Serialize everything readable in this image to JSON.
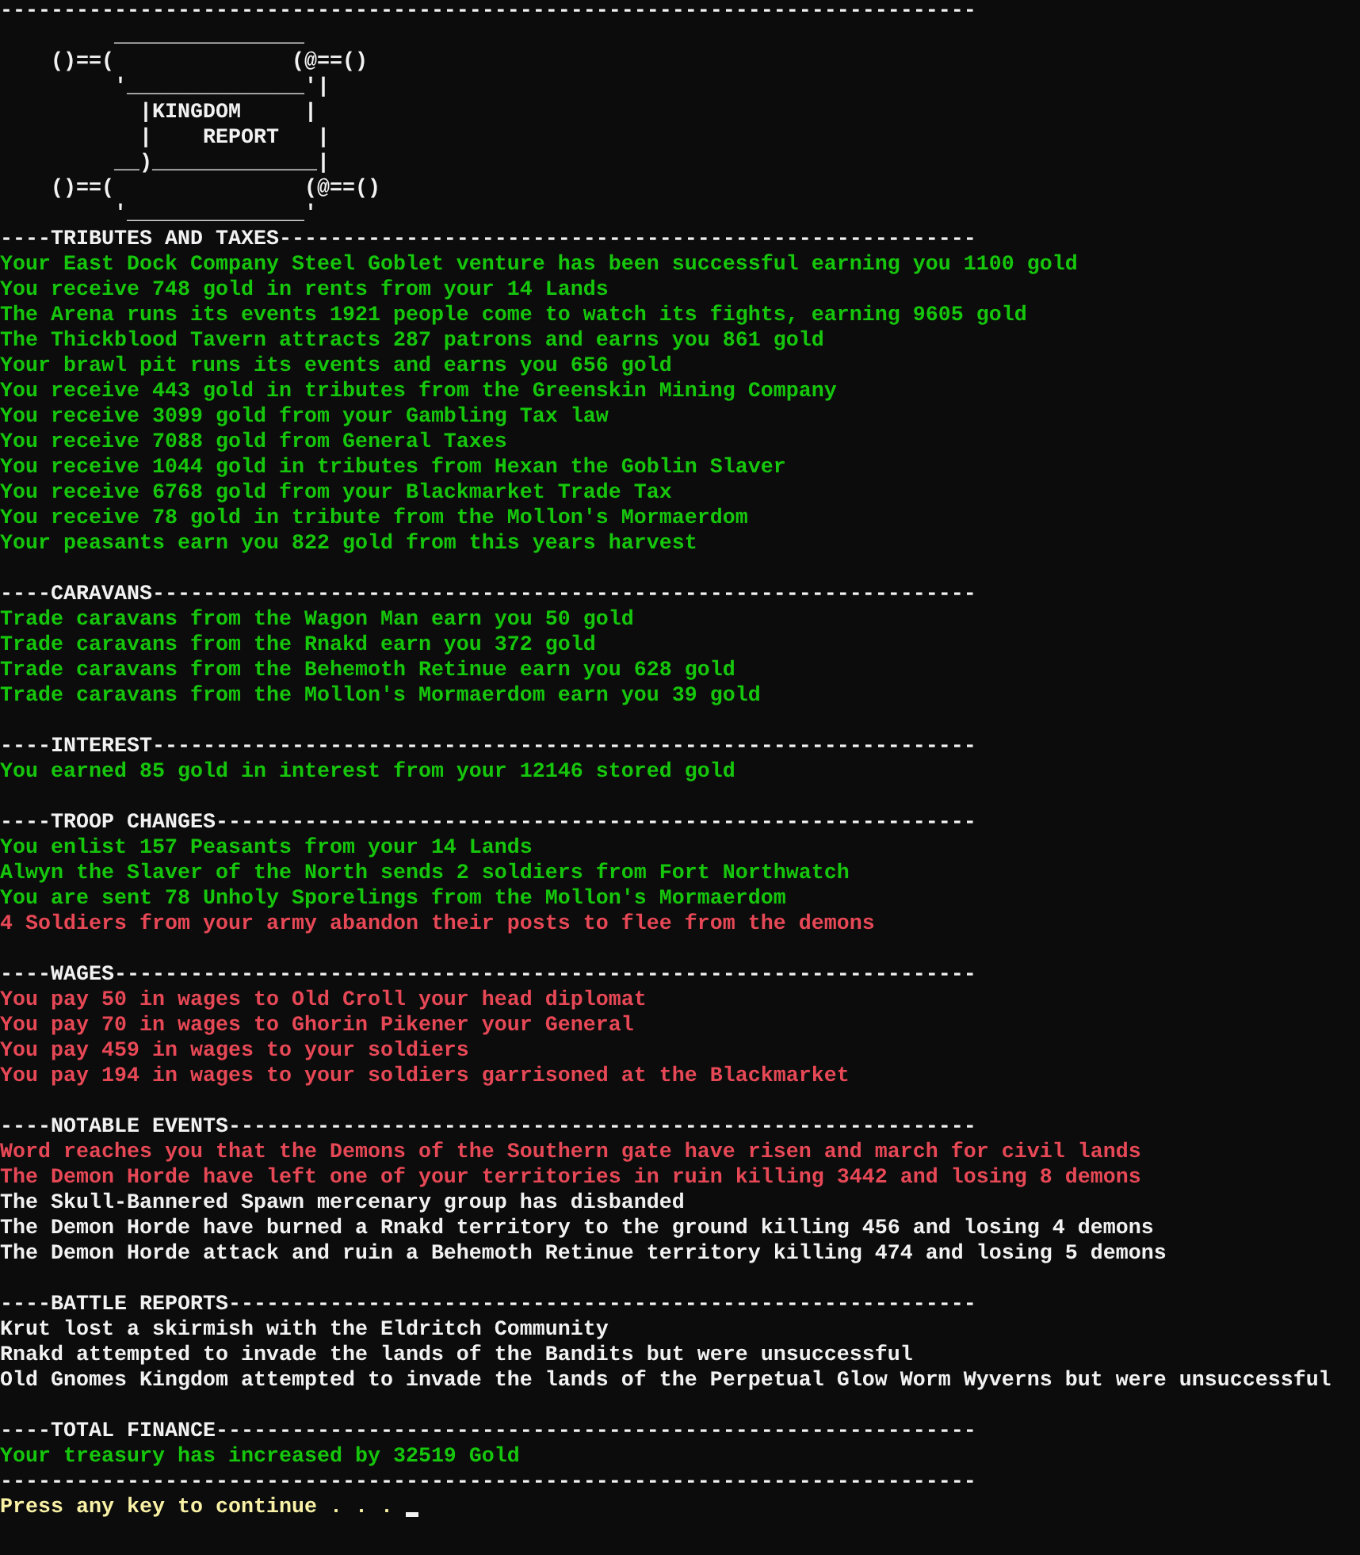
{
  "top_rule": "-----------------------------------------------------------------------------",
  "banner": [
    "         _______________",
    "    ()==(              (@==()",
    "         '______________'|",
    "           |KINGDOM     |",
    "           |    REPORT   |",
    "         __)_____________|",
    "    ()==(               (@==()",
    "         '______________'"
  ],
  "sections": [
    {
      "header": "----TRIBUTES AND TAXES-------------------------------------------------------",
      "lines": [
        {
          "text": "Your East Dock Company Steel Goblet venture has been successful earning you 1100 gold",
          "color": "#16c60c"
        },
        {
          "text": "You receive 748 gold in rents from your 14 Lands",
          "color": "#16c60c"
        },
        {
          "text": "The Arena runs its events 1921 people come to watch its fights, earning 9605 gold",
          "color": "#16c60c"
        },
        {
          "text": "The Thickblood Tavern attracts 287 patrons and earns you 861 gold",
          "color": "#16c60c"
        },
        {
          "text": "Your brawl pit runs its events and earns you 656 gold",
          "color": "#16c60c"
        },
        {
          "text": "You receive 443 gold in tributes from the Greenskin Mining Company",
          "color": "#16c60c"
        },
        {
          "text": "You receive 3099 gold from your Gambling Tax law",
          "color": "#16c60c"
        },
        {
          "text": "You receive 7088 gold from General Taxes",
          "color": "#16c60c"
        },
        {
          "text": "You receive 1044 gold in tributes from Hexan the Goblin Slaver",
          "color": "#16c60c"
        },
        {
          "text": "You receive 6768 gold from your Blackmarket Trade Tax",
          "color": "#16c60c"
        },
        {
          "text": "You receive 78 gold in tribute from the Mollon's Mormaerdom",
          "color": "#16c60c"
        },
        {
          "text": "Your peasants earn you 822 gold from this years harvest",
          "color": "#16c60c"
        }
      ]
    },
    {
      "header": "----CARAVANS-----------------------------------------------------------------",
      "lines": [
        {
          "text": "Trade caravans from the Wagon Man earn you 50 gold",
          "color": "#16c60c"
        },
        {
          "text": "Trade caravans from the Rnakd earn you 372 gold",
          "color": "#16c60c"
        },
        {
          "text": "Trade caravans from the Behemoth Retinue earn you 628 gold",
          "color": "#16c60c"
        },
        {
          "text": "Trade caravans from the Mollon's Mormaerdom earn you 39 gold",
          "color": "#16c60c"
        }
      ]
    },
    {
      "header": "----INTEREST-----------------------------------------------------------------",
      "lines": [
        {
          "text": "You earned 85 gold in interest from your 12146 stored gold",
          "color": "#16c60c"
        }
      ]
    },
    {
      "header": "----TROOP CHANGES------------------------------------------------------------",
      "lines": [
        {
          "text": "You enlist 157 Peasants from your 14 Lands",
          "color": "#16c60c"
        },
        {
          "text": "Alwyn the Slaver of the North sends 2 soldiers from Fort Northwatch",
          "color": "#16c60c"
        },
        {
          "text": "You are sent 78 Unholy Sporelings from the Mollon's Mormaerdom",
          "color": "#16c60c"
        },
        {
          "text": "4 Soldiers from your army abandon their posts to flee from the demons",
          "color": "#e74856"
        }
      ]
    },
    {
      "header": "----WAGES--------------------------------------------------------------------",
      "lines": [
        {
          "text": "You pay 50 in wages to Old Croll your head diplomat",
          "color": "#e74856"
        },
        {
          "text": "You pay 70 in wages to Ghorin Pikener your General",
          "color": "#e74856"
        },
        {
          "text": "You pay 459 in wages to your soldiers",
          "color": "#e74856"
        },
        {
          "text": "You pay 194 in wages to your soldiers garrisoned at the Blackmarket",
          "color": "#e74856"
        }
      ]
    },
    {
      "header": "----NOTABLE EVENTS-----------------------------------------------------------",
      "lines": [
        {
          "text": "Word reaches you that the Demons of the Southern gate have risen and march for civil lands",
          "color": "#e74856"
        },
        {
          "text": "The Demon Horde have left one of your territories in ruin killing 3442 and losing 8 demons",
          "color": "#e74856"
        },
        {
          "text": "The Skull-Bannered Spawn mercenary group has disbanded",
          "color": "#f2f2f2"
        },
        {
          "text": "The Demon Horde have burned a Rnakd territory to the ground killing 456 and losing 4 demons",
          "color": "#f2f2f2"
        },
        {
          "text": "The Demon Horde attack and ruin a Behemoth Retinue territory killing 474 and losing 5 demons",
          "color": "#f2f2f2"
        }
      ]
    },
    {
      "header": "----BATTLE REPORTS-----------------------------------------------------------",
      "lines": [
        {
          "text": "Krut lost a skirmish with the Eldritch Community",
          "color": "#f2f2f2"
        },
        {
          "text": "Rnakd attempted to invade the lands of the Bandits but were unsuccessful",
          "color": "#f2f2f2"
        },
        {
          "text": "Old Gnomes Kingdom attempted to invade the lands of the Perpetual Glow Worm Wyverns but were unsuccessful",
          "color": "#f2f2f2"
        }
      ]
    },
    {
      "header": "----TOTAL FINANCE------------------------------------------------------------",
      "lines": [
        {
          "text": "Your treasury has increased by 32519 Gold",
          "color": "#16c60c"
        }
      ]
    }
  ],
  "closing_rule": "-----------------------------------------------------------------------------",
  "prompt": "Press any key to continue . . ."
}
